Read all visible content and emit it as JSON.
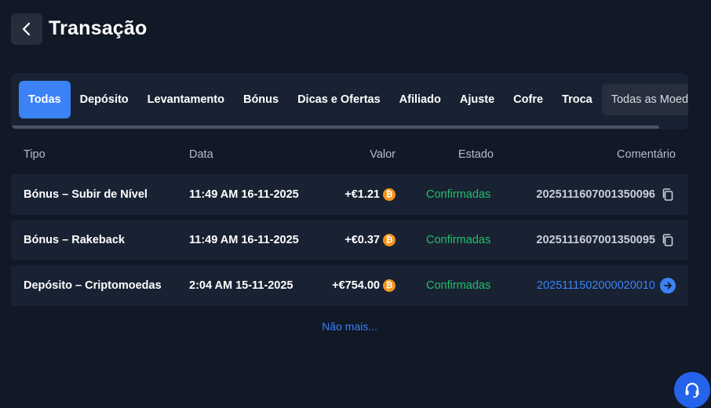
{
  "header": {
    "title": "Transação",
    "back_icon": "chevron-left-icon"
  },
  "tabs": [
    {
      "label": "Todas",
      "active": true
    },
    {
      "label": "Depósito",
      "active": false
    },
    {
      "label": "Levantamento",
      "active": false
    },
    {
      "label": "Bónus",
      "active": false
    },
    {
      "label": "Dicas e Ofertas",
      "active": false
    },
    {
      "label": "Afiliado",
      "active": false
    },
    {
      "label": "Ajuste",
      "active": false
    },
    {
      "label": "Cofre",
      "active": false
    },
    {
      "label": "Troca",
      "active": false
    }
  ],
  "coin_filter": {
    "label": "Todas as Moedas"
  },
  "table": {
    "columns": [
      "Tipo",
      "Data",
      "Valor",
      "Estado",
      "Comentário"
    ],
    "rows": [
      {
        "type": "Bónus – Subir de Nível",
        "date": "11:49 AM 16-11-2025",
        "value": "+€1.21",
        "status": "Confirmadas",
        "comment": "2025111607001350096",
        "comment_action": "copy-icon"
      },
      {
        "type": "Bónus – Rakeback",
        "date": "11:49 AM 16-11-2025",
        "value": "+€0.37",
        "status": "Confirmadas",
        "comment": "2025111607001350095",
        "comment_action": "copy-icon"
      },
      {
        "type": "Depósito – Criptomoedas",
        "date": "2:04 AM 15-11-2025",
        "value": "+€754.00",
        "status": "Confirmadas",
        "comment": "2025111502000020010",
        "comment_action": "arrow-right-icon"
      }
    ]
  },
  "no_more": "Não mais...",
  "support_icon": "headset-icon",
  "colors": {
    "background": "#111826",
    "panel": "#192232",
    "accent": "#3b82f6",
    "success": "#20c06c",
    "coin": "#f7931a"
  }
}
